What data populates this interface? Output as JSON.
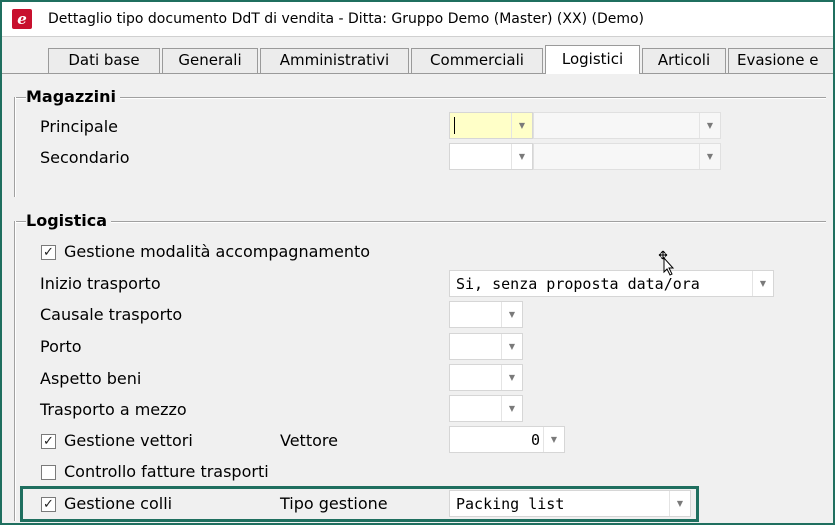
{
  "window": {
    "title": "Dettaglio tipo documento DdT di vendita - Ditta: Gruppo Demo (Master) (XX)  (Demo)",
    "app_icon": "e"
  },
  "tabs": [
    {
      "label": "Dati base"
    },
    {
      "label": "Generali"
    },
    {
      "label": "Amministrativi"
    },
    {
      "label": "Commerciali"
    },
    {
      "label": "Logistici",
      "active": true
    },
    {
      "label": "Articoli"
    },
    {
      "label": "Evasione e"
    }
  ],
  "magazzini": {
    "title": "Magazzini",
    "principale_label": "Principale",
    "secondario_label": "Secondario"
  },
  "logistica": {
    "title": "Logistica",
    "gestione_accompagnamento": {
      "label": "Gestione modalità accompagnamento",
      "checked": true,
      "mark": "✓"
    },
    "inizio_trasporto": {
      "label": "Inizio trasporto",
      "value": "Si, senza proposta data/ora"
    },
    "causale_trasporto": {
      "label": "Causale trasporto"
    },
    "porto": {
      "label": "Porto"
    },
    "aspetto_beni": {
      "label": "Aspetto beni"
    },
    "trasporto_a_mezzo": {
      "label": "Trasporto a mezzo"
    },
    "gestione_vettori": {
      "label": "Gestione vettori",
      "checked": true,
      "mark": "✓"
    },
    "vettore": {
      "label": "Vettore",
      "value": "0"
    },
    "controllo_fatture": {
      "label": "Controllo fatture trasporti",
      "checked": false
    },
    "gestione_colli": {
      "label": "Gestione colli",
      "checked": true,
      "mark": "✓"
    },
    "tipo_gestione": {
      "label": "Tipo gestione",
      "value": "Packing list"
    }
  },
  "icons": {
    "dropdown_arrow": "▼",
    "cursor": "move-cursor-icon"
  },
  "colors": {
    "highlight_border": "#1f6f5f",
    "focused_field": "#ffffc8",
    "app_icon": "#c8102e"
  }
}
